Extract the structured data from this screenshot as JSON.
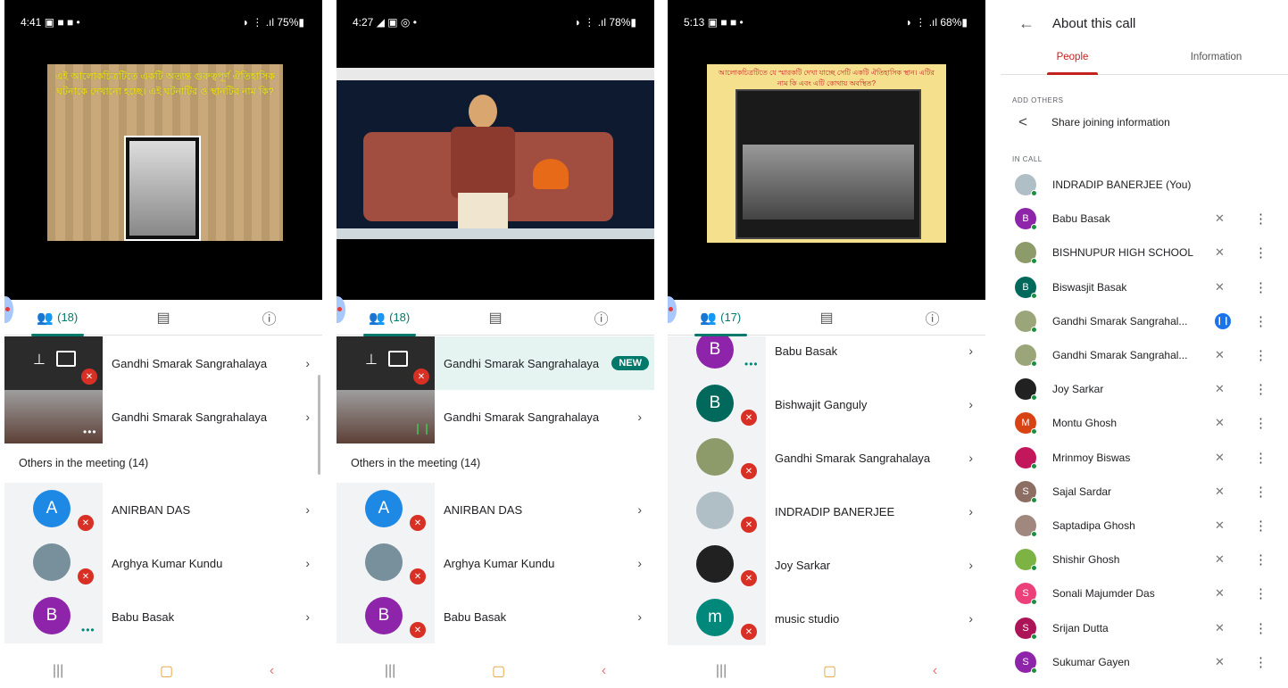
{
  "phones": [
    {
      "status": {
        "time": "4:41 ▣ ■ ■ •",
        "right": "◗ ⋮ .ıl 75%▮"
      },
      "slide_text": "এই আলোকচিত্রটিতে একটি অত্যন্ত গুরুত্বপূর্ণ ঐতিহাসিক ঘটনাকে দেখানো হচ্ছে। এই ঘটনাটির ও স্থানটির নাম কি?",
      "tabs": {
        "people_count": "(18)"
      },
      "pinned": [
        {
          "name": "Gandhi Smarak Sangrahalaya"
        },
        {
          "name": "Gandhi Smarak Sangrahalaya"
        }
      ],
      "others_label": "Others in the meeting (14)",
      "others": [
        {
          "initial": "A",
          "name": "ANIRBAN DAS",
          "color": "#1e88e5"
        },
        {
          "initial": "",
          "name": "Arghya Kumar Kundu",
          "color": "#78909c"
        },
        {
          "initial": "B",
          "name": "Babu Basak",
          "color": "#8e24aa"
        }
      ]
    },
    {
      "status": {
        "time": "4:27 ◢ ▣ ◎ •",
        "right": "◗ ⋮ .ıl 78%▮"
      },
      "tabs": {
        "people_count": "(18)"
      },
      "pinned": [
        {
          "name": "Gandhi Smarak Sangrahalaya",
          "badge": "NEW"
        },
        {
          "name": "Gandhi Smarak Sangrahalaya"
        }
      ],
      "others_label": "Others in the meeting (14)",
      "others": [
        {
          "initial": "A",
          "name": "ANIRBAN DAS",
          "color": "#1e88e5"
        },
        {
          "initial": "",
          "name": "Arghya Kumar Kundu",
          "color": "#78909c"
        },
        {
          "initial": "B",
          "name": "Babu Basak",
          "color": "#8e24aa"
        }
      ]
    },
    {
      "status": {
        "time": "5:13 ▣ ■ ■ •",
        "right": "◗ ⋮ .ıl 68%▮"
      },
      "slide_header": "আলোকচিত্রটিতে যে স্মারকটি দেখা যাচ্ছে সেটি একটি ঐতিহাসিক স্থান। এটির নাম কি এবং এটি কোথায় অবস্থিত?",
      "tabs": {
        "people_count": "(17)"
      },
      "list": [
        {
          "initial": "B",
          "name": "Babu Basak",
          "color": "#8e24aa"
        },
        {
          "initial": "B",
          "name": "Bishwajit Ganguly",
          "color": "#00695c"
        },
        {
          "initial": "",
          "name": "Gandhi Smarak Sangrahalaya",
          "color": "#8d9a6a"
        },
        {
          "initial": "",
          "name": "INDRADIP BANERJEE",
          "color": "#b0bec5"
        },
        {
          "initial": "",
          "name": "Joy Sarkar",
          "color": "#212121"
        },
        {
          "initial": "m",
          "name": "music studio",
          "color": "#00897b"
        }
      ]
    }
  ],
  "about": {
    "title": "About this call",
    "tab_people": "People",
    "tab_info": "Information",
    "add_others_label": "ADD OTHERS",
    "share_label": "Share joining information",
    "in_call_label": "IN CALL",
    "people": [
      {
        "initial": "",
        "name": "INDRADIP BANERJEE (You)",
        "color": "#b0bec5",
        "mic": ""
      },
      {
        "initial": "B",
        "name": "Babu Basak",
        "color": "#8e24aa",
        "mic": "muted"
      },
      {
        "initial": "",
        "name": "BISHNUPUR HIGH SCHOOL",
        "color": "#8d9a6a",
        "mic": "muted"
      },
      {
        "initial": "B",
        "name": "Biswasjit Basak",
        "color": "#00695c",
        "mic": "muted"
      },
      {
        "initial": "",
        "name": "Gandhi Smarak Sangrahal...",
        "color": "#9aa57a",
        "mic": "talking"
      },
      {
        "initial": "",
        "name": "Gandhi Smarak Sangrahal...",
        "color": "#9aa57a",
        "mic": "muted"
      },
      {
        "initial": "",
        "name": "Joy Sarkar",
        "color": "#212121",
        "mic": "muted"
      },
      {
        "initial": "M",
        "name": "Montu Ghosh",
        "color": "#d84315",
        "mic": "muted"
      },
      {
        "initial": "",
        "name": "Mrinmoy Biswas",
        "color": "#c2185b",
        "mic": "muted"
      },
      {
        "initial": "S",
        "name": "Sajal Sardar",
        "color": "#8d6e63",
        "mic": "muted"
      },
      {
        "initial": "",
        "name": "Saptadipa Ghosh",
        "color": "#a1887f",
        "mic": "muted"
      },
      {
        "initial": "",
        "name": "Shishir Ghosh",
        "color": "#7cb342",
        "mic": "muted"
      },
      {
        "initial": "S",
        "name": "Sonali Majumder Das",
        "color": "#ec407a",
        "mic": "muted"
      },
      {
        "initial": "S",
        "name": "Srijan Dutta",
        "color": "#ad1457",
        "mic": "muted"
      },
      {
        "initial": "S",
        "name": "Sukumar Gayen",
        "color": "#8e24aa",
        "mic": "muted"
      }
    ]
  },
  "icons": {
    "chevron": "›",
    "muted": "✕",
    "more": "⋮",
    "back": "←",
    "share": "<",
    "talking": "❙❙"
  }
}
